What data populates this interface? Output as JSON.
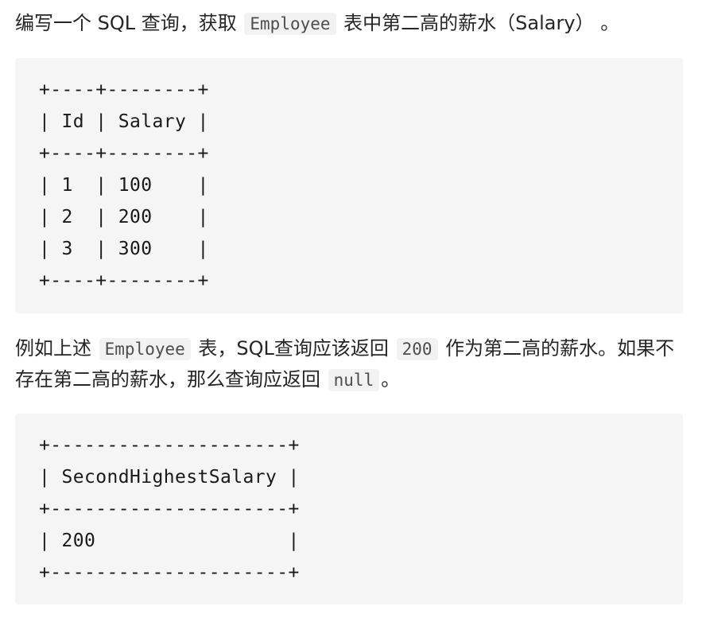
{
  "intro": {
    "text_before": "编写一个 SQL 查询，获取 ",
    "code": "Employee",
    "text_after": " 表中第二高的薪水（Salary） 。"
  },
  "table_example": {
    "lines": [
      "+----+--------+",
      "| Id | Salary |",
      "+----+--------+",
      "| 1  | 100    |",
      "| 2  | 200    |",
      "| 3  | 300    |",
      "+----+--------+"
    ]
  },
  "explanation": {
    "part1": "例如上述 ",
    "code1": "Employee",
    "part2": " 表，SQL查询应该返回 ",
    "code2": "200",
    "part3": " 作为第二高的薪水。如果不存在第二高的薪水，那么查询应返回 ",
    "code3": "null",
    "part4": "。"
  },
  "result_example": {
    "lines": [
      "+---------------------+",
      "| SecondHighestSalary |",
      "+---------------------+",
      "| 200                 |",
      "+---------------------+"
    ]
  }
}
